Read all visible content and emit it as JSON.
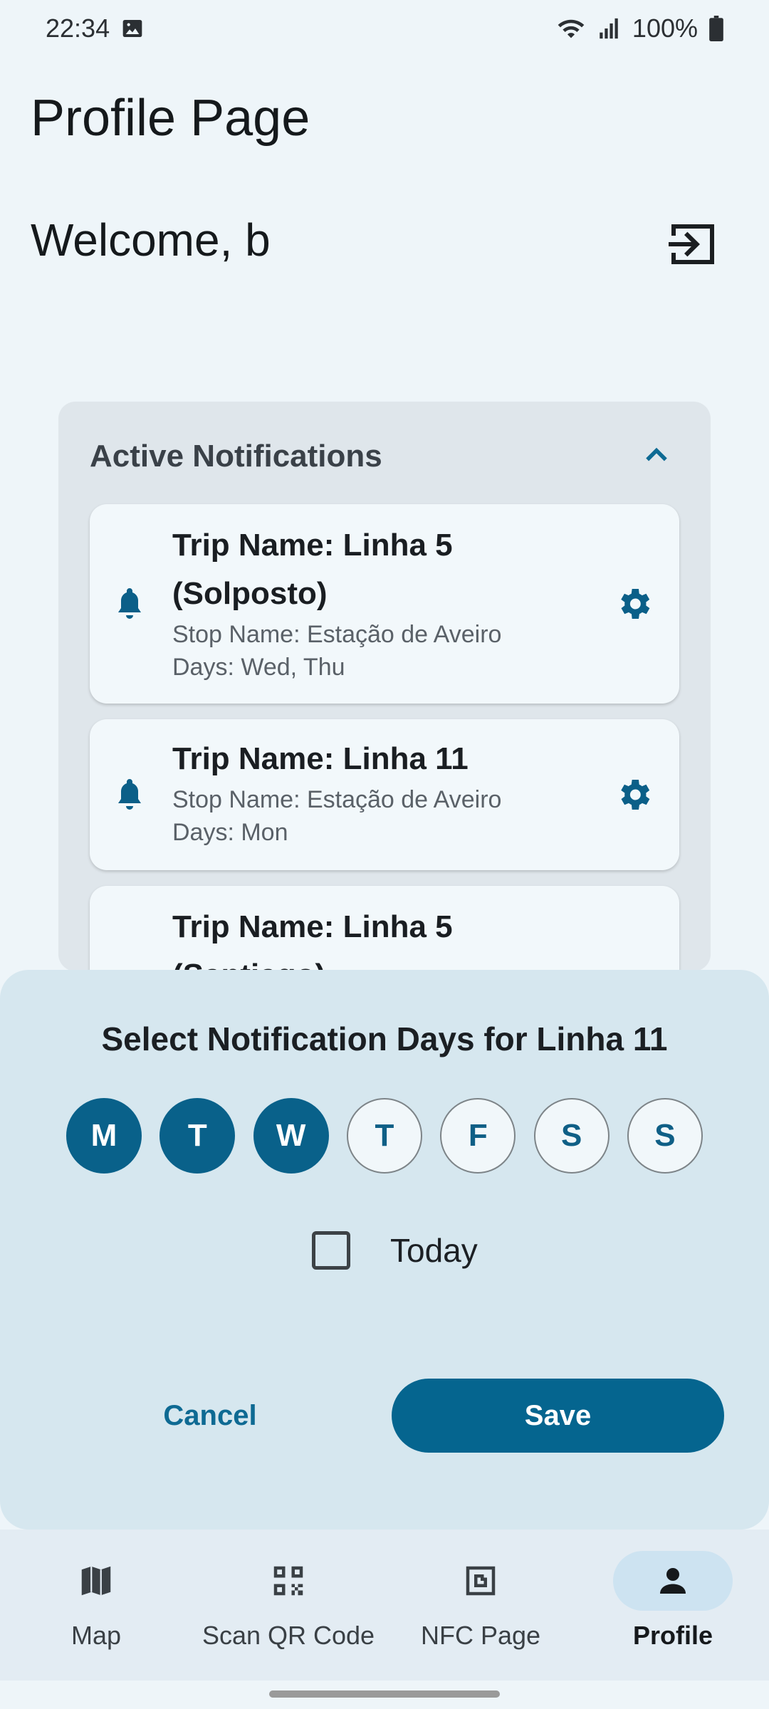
{
  "status_bar": {
    "time": "22:34",
    "battery": "100%",
    "icons": [
      "image-icon",
      "wifi-icon",
      "signal-icon",
      "battery-icon"
    ]
  },
  "page": {
    "title": "Profile Page",
    "welcome": "Welcome, b",
    "logout_icon": "logout-icon"
  },
  "notifications": {
    "title": "Active Notifications",
    "items": [
      {
        "trip": "Trip Name: Linha 5 (Solposto)",
        "stop": "Stop Name: Estação de Aveiro",
        "days": "Days: Wed, Thu"
      },
      {
        "trip": "Trip Name: Linha 11",
        "stop": "Stop Name: Estação de Aveiro",
        "days": "Days: Mon"
      },
      {
        "trip": "Trip Name: Linha 5 (Santiago)",
        "stop": "",
        "days": ""
      }
    ]
  },
  "dialog": {
    "title": "Select Notification Days for Linha 11",
    "days": [
      {
        "label": "M",
        "selected": true
      },
      {
        "label": "T",
        "selected": true
      },
      {
        "label": "W",
        "selected": true
      },
      {
        "label": "T",
        "selected": false
      },
      {
        "label": "F",
        "selected": false
      },
      {
        "label": "S",
        "selected": false
      },
      {
        "label": "S",
        "selected": false
      }
    ],
    "today_label": "Today",
    "today_checked": false,
    "cancel_label": "Cancel",
    "save_label": "Save"
  },
  "bottom_nav": {
    "items": [
      {
        "label": "Map",
        "icon": "map-icon",
        "active": false
      },
      {
        "label": "Scan QR Code",
        "icon": "qr-code-icon",
        "active": false
      },
      {
        "label": "NFC Page",
        "icon": "nfc-icon",
        "active": false
      },
      {
        "label": "Profile",
        "icon": "person-icon",
        "active": true
      }
    ]
  },
  "colors": {
    "primary": "#05658f",
    "background": "#eef5f9",
    "sheet": "#d6e7ef"
  }
}
